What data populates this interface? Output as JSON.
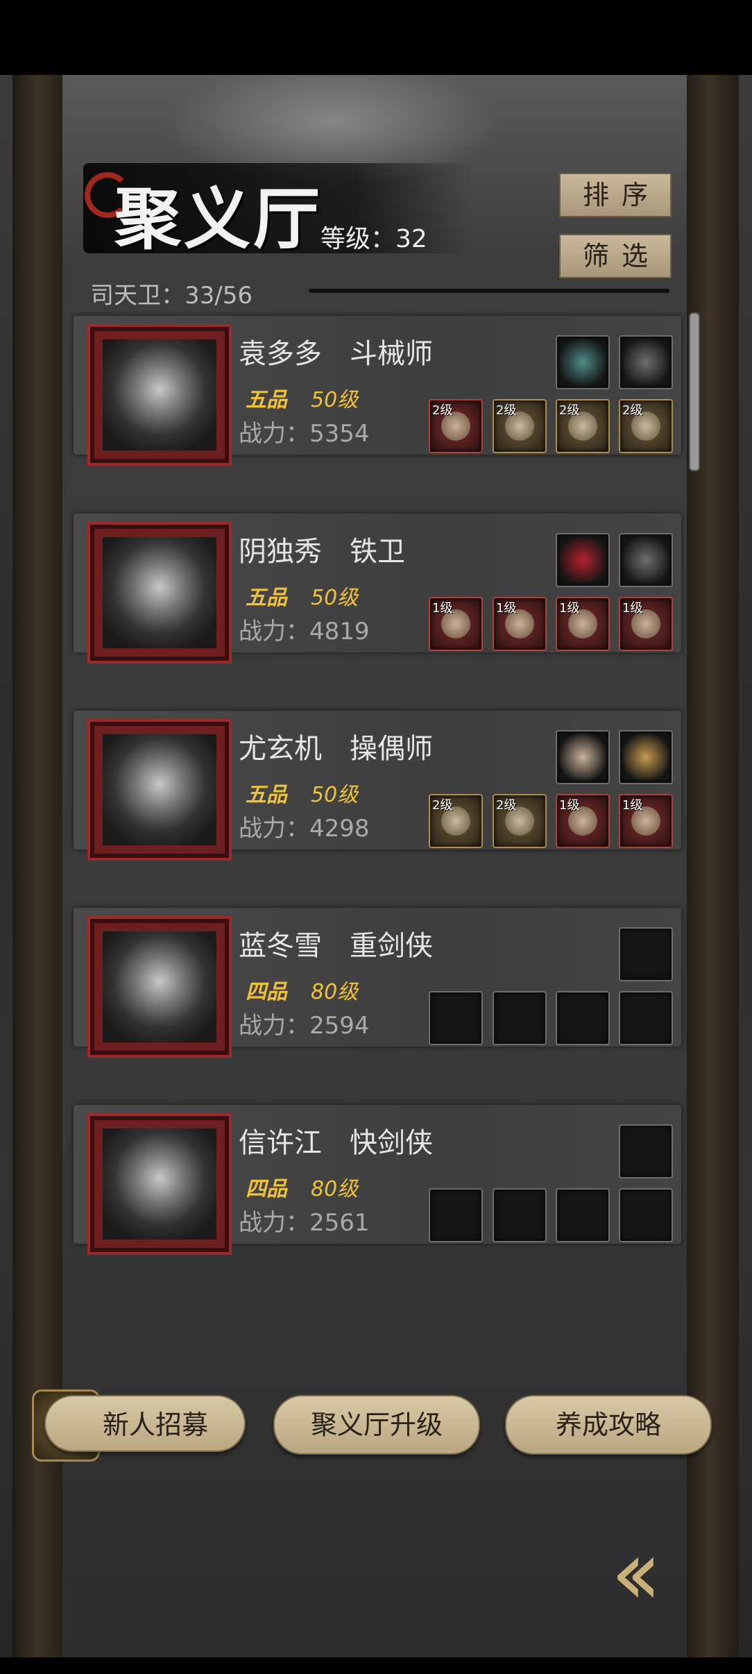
{
  "header": {
    "title": "聚义厅",
    "level_text": "等级：32",
    "sort_label": "排序",
    "filter_label": "筛选",
    "roster_text": "司天卫：33/56"
  },
  "heroes": [
    {
      "name": "袁多多　斗械师",
      "grade": "五品",
      "level": "50级",
      "power": "战力：5354",
      "top_slots": [
        "teal",
        "steel"
      ],
      "equip": [
        {
          "tag": "2级",
          "style": "red"
        },
        {
          "tag": "2级",
          "style": "gold"
        },
        {
          "tag": "2级",
          "style": "gold"
        },
        {
          "tag": "2级",
          "style": "gold"
        }
      ]
    },
    {
      "name": "阴独秀　铁卫",
      "grade": "五品",
      "level": "50级",
      "power": "战力：4819",
      "top_slots": [
        "crimson",
        "steel"
      ],
      "equip": [
        {
          "tag": "1级",
          "style": "red"
        },
        {
          "tag": "1级",
          "style": "red"
        },
        {
          "tag": "1级",
          "style": "red"
        },
        {
          "tag": "1级",
          "style": "red"
        }
      ]
    },
    {
      "name": "尤玄机　操偶师",
      "grade": "五品",
      "level": "50级",
      "power": "战力：4298",
      "top_slots": [
        "scroll",
        "bronze"
      ],
      "equip": [
        {
          "tag": "2级",
          "style": "gold"
        },
        {
          "tag": "2级",
          "style": "gold"
        },
        {
          "tag": "1级",
          "style": "red"
        },
        {
          "tag": "1级",
          "style": "red"
        }
      ]
    },
    {
      "name": "蓝冬雪　重剑侠",
      "grade": "四品",
      "level": "80级",
      "power": "战力：2594",
      "top_slots": [
        "empty"
      ],
      "equip": [
        {
          "tag": "",
          "style": "empty"
        },
        {
          "tag": "",
          "style": "empty"
        },
        {
          "tag": "",
          "style": "empty"
        },
        {
          "tag": "",
          "style": "empty"
        }
      ]
    },
    {
      "name": "信许江　快剑侠",
      "grade": "四品",
      "level": "80级",
      "power": "战力：2561",
      "top_slots": [
        "empty"
      ],
      "equip": [
        {
          "tag": "",
          "style": "empty"
        },
        {
          "tag": "",
          "style": "empty"
        },
        {
          "tag": "",
          "style": "empty"
        },
        {
          "tag": "",
          "style": "empty"
        }
      ]
    }
  ],
  "bottom_buttons": {
    "recruit": "新人招募",
    "upgrade": "聚义厅升级",
    "guide": "养成攻略"
  },
  "icons": {
    "back": "double-chevron-left-icon",
    "recruit_badge": "recruit-token-icon"
  }
}
